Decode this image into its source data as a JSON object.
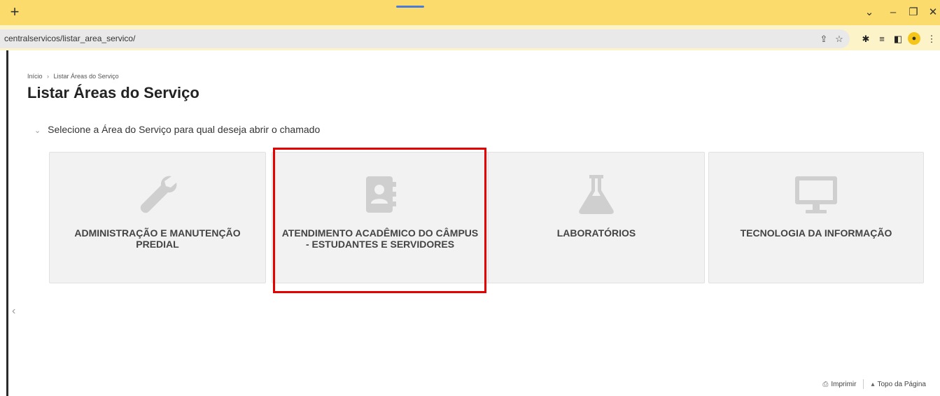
{
  "browser": {
    "new_tab": "+",
    "url": "centralservicos/listar_area_servico/",
    "controls": {
      "dropdown": "⌄",
      "minimize": "–",
      "restore": "❐",
      "close": "✕"
    }
  },
  "breadcrumb": {
    "home": "Início",
    "separator": "›",
    "current": "Listar Áreas do Serviço"
  },
  "page_title": "Listar Áreas do Serviço",
  "section": {
    "chevron": "⌄",
    "title": "Selecione a Área do Serviço para qual deseja abrir o chamado"
  },
  "cards": [
    {
      "label": "ADMINISTRAÇÃO E MANUTENÇÃO PREDIAL",
      "icon": "wrench-icon"
    },
    {
      "label": "ATENDIMENTO ACADÊMICO DO CÂMPUS - ESTUDANTES E SERVIDORES",
      "icon": "address-book-icon"
    },
    {
      "label": "LABORATÓRIOS",
      "icon": "flask-icon"
    },
    {
      "label": "TECNOLOGIA DA INFORMAÇÃO",
      "icon": "monitor-icon"
    }
  ],
  "footer": {
    "print_label": "Imprimir",
    "top_label": "Topo da Página"
  },
  "colors": {
    "tabbar": "#fbdb6b",
    "card_bg": "#f2f2f2",
    "icon": "#cfcfcf",
    "highlight": "#e60000"
  }
}
